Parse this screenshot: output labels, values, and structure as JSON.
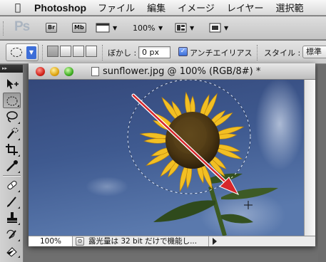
{
  "menubar": {
    "apple": "",
    "app_name": "Photoshop",
    "items": [
      "ファイル",
      "編集",
      "イメージ",
      "レイヤー",
      "選択範"
    ]
  },
  "appbar": {
    "logo": "Ps",
    "bridge_label": "Br",
    "minibridge_label": "Mb",
    "zoom": "100%"
  },
  "options": {
    "feather_label": "ぼかし :",
    "feather_value": "0 px",
    "antialias_label": "アンチエイリアス",
    "style_label": "スタイル :",
    "style_value": "標準"
  },
  "document": {
    "title": "sunflower.jpg @ 100% (RGB/8#) *",
    "zoom": "100%",
    "status": "露光量は 32 bit だけで機能し..."
  },
  "colors": {
    "sky": "#3c5488",
    "arrow": "#d7262b",
    "petal": "#f2bf23"
  },
  "icons": {
    "toolbox": [
      "move-icon",
      "elliptical-marquee-icon",
      "lasso-icon",
      "quick-selection-icon",
      "crop-icon",
      "eyedropper-icon",
      "healing-brush-icon",
      "brush-icon",
      "clone-stamp-icon",
      "history-brush-icon",
      "eraser-icon"
    ]
  }
}
